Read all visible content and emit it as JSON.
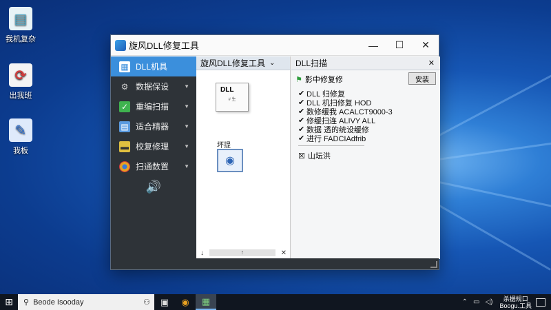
{
  "desktop": {
    "icons": [
      {
        "label": "我机复杂",
        "glyph": "📄",
        "color": "#4aa8c8"
      },
      {
        "label": "出我班",
        "glyph": "⟳",
        "color": "#d43b3b"
      },
      {
        "label": "我板",
        "glyph": "✎",
        "color": "#2b6fd4"
      }
    ]
  },
  "window": {
    "title": "旋风DLL修复工具",
    "controls": {
      "minimize": "—",
      "maximize": "☐",
      "close": "✕"
    }
  },
  "sidebar": {
    "items": [
      {
        "label": "DLL机具",
        "icon": "window-icon",
        "glyph": "▦",
        "color": "#ffffff",
        "active": true,
        "arrow": ""
      },
      {
        "label": "数据保设",
        "icon": "gears-icon",
        "glyph": "⚙",
        "color": "#cccccc",
        "active": false,
        "arrow": "▼"
      },
      {
        "label": "重编扫描",
        "icon": "checkmark-icon",
        "glyph": "✓",
        "color": "#3fb34f",
        "active": false,
        "arrow": "▼"
      },
      {
        "label": "适合精器",
        "icon": "folder-icon",
        "glyph": "▤",
        "color": "#5b9be0",
        "active": false,
        "arrow": "▼"
      },
      {
        "label": "校复修理",
        "icon": "tools-icon",
        "glyph": "▬",
        "color": "#e0c040",
        "active": false,
        "arrow": "▼"
      },
      {
        "label": "扫通数置",
        "icon": "chrome-icon",
        "glyph": "●",
        "color": "#e7a020",
        "active": false,
        "arrow": "▼"
      }
    ],
    "speaker_glyph": "🔊"
  },
  "middle_panel": {
    "header": "旋风DLL修复工具",
    "header_arrow": "⌄",
    "thumb_title": "DLL",
    "thumb_sub": "# 生",
    "caption": "坏提",
    "bottom_left": "↓",
    "bottom_mid": "↑",
    "bottom_right": "✕"
  },
  "right_panel": {
    "header": "DLL扫描",
    "close": "✕",
    "status": "影中修复修",
    "confirm": "安装",
    "checks": [
      "DLL 归修复",
      "DLL 机扫修复 HOD",
      "数修缓我 ACALCT9000-3",
      "修缓扫连 ALIVY ALL",
      "数据 透的统设缓修",
      "进行 FADCIAdfrib"
    ],
    "scan_label": "山坛洪"
  },
  "taskbar": {
    "search_text": "Beode Isooday",
    "clock_line1": "杀据规口",
    "clock_line2": "Boogu.工具"
  }
}
